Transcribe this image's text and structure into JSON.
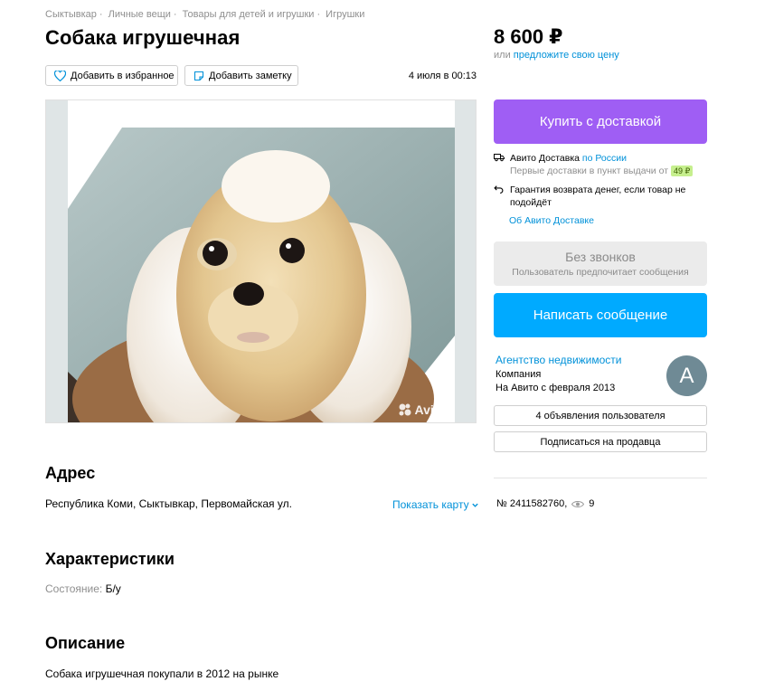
{
  "breadcrumbs": [
    "Сыктывкар",
    "Личные вещи",
    "Товары для детей и игрушки",
    "Игрушки"
  ],
  "title": "Собака игрушечная",
  "actions": {
    "favorite": "Добавить в избранное",
    "note": "Добавить заметку"
  },
  "date": "4 июля в 00:13",
  "photo": {
    "watermark": "Avito",
    "alt_icon": "dog-toy-photo"
  },
  "price": "8 600 ₽",
  "offer": {
    "prefix": "или",
    "link": "предложите свою цену"
  },
  "buy_button": "Купить с доставкой",
  "delivery": {
    "line1_prefix": "Авито Доставка",
    "line1_link": "по России",
    "line2": "Первые доставки в пункт выдачи от",
    "line2_price": "49 ₽",
    "guarantee": "Гарантия возврата денег, если товар не подойдёт",
    "about_link": "Об Авито Доставке"
  },
  "no_calls": {
    "title": "Без звонков",
    "subtitle": "Пользователь предпочитает сообщения"
  },
  "message_button": "Написать сообщение",
  "seller": {
    "name": "Агентство недвижимости",
    "type": "Компания",
    "since": "На Авито с февраля 2013",
    "avatar_letter": "A"
  },
  "seller_buttons": {
    "listings": "4 объявления пользователя",
    "subscribe": "Подписаться на продавца"
  },
  "listing_meta": {
    "number": "№ 2411582760,",
    "views": "9"
  },
  "address": {
    "heading": "Адрес",
    "text": "Республика Коми, Сыктывкар, Первомайская ул.",
    "map_link": "Показать карту"
  },
  "specs": {
    "heading": "Характеристики",
    "label": "Состояние:",
    "value": "Б/у"
  },
  "description": {
    "heading": "Описание",
    "text": "Собака игрушечная покупали в 2012 на рынке"
  },
  "colors": {
    "accent_blue": "#0091d9",
    "buy_purple": "#9f5ef4",
    "message_blue": "#00aaff"
  }
}
